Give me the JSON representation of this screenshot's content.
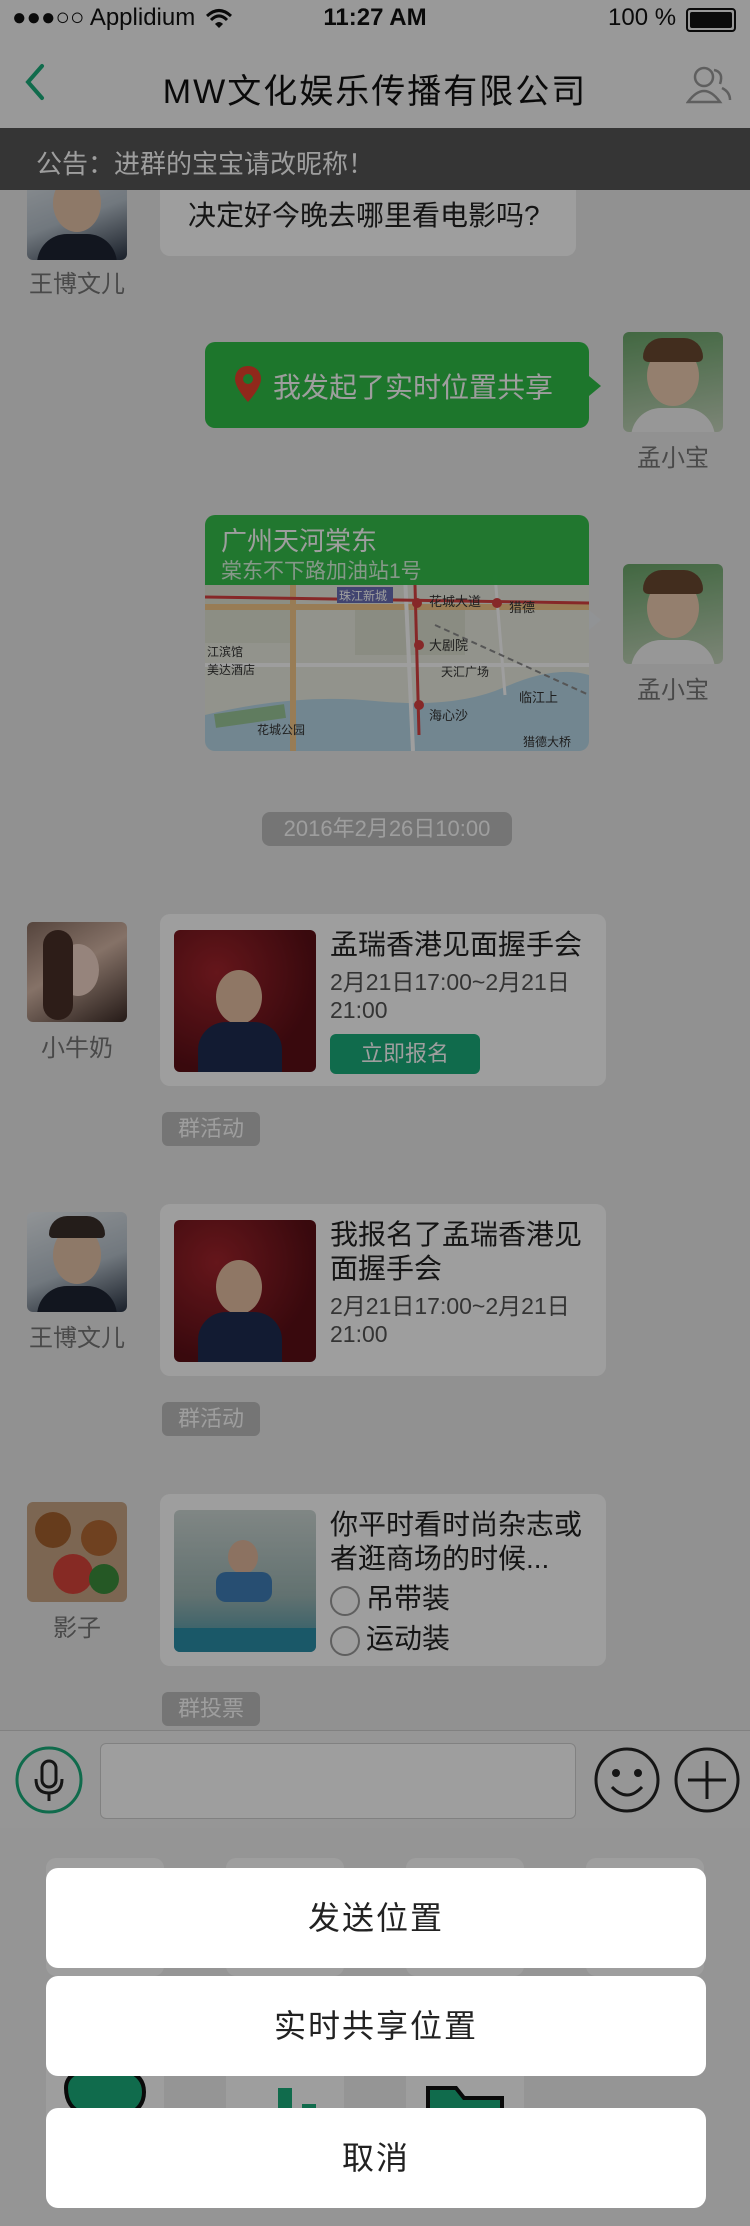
{
  "status_bar": {
    "carrier": "●●●○○ Applidium",
    "time": "11:27 AM",
    "battery": "100 %"
  },
  "nav": {
    "title": "MW文化娱乐传播有限公司"
  },
  "notice": {
    "text": "公告：进群的宝宝请改昵称！"
  },
  "messages": {
    "m1": {
      "sender": "王博文儿",
      "text": "决定好今晚去哪里看电影吗?"
    },
    "m2": {
      "sender": "孟小宝",
      "text": "我发起了实时位置共享"
    },
    "m3": {
      "sender": "孟小宝",
      "place": "广州天河棠东",
      "address": "棠东不下路加油站1号",
      "map_labels": [
        "珠江新城",
        "花城大道",
        "猎德",
        "大剧院",
        "江滨馆",
        "美达酒店",
        "天汇广场",
        "临江上",
        "海心沙",
        "花城公园",
        "猎德大桥"
      ]
    },
    "timestamp": "2016年2月26日10:00",
    "m4": {
      "sender": "小牛奶",
      "title": "孟瑞香港见面握手会",
      "time": "2月21日17:00~2月21日21:00",
      "button": "立即报名",
      "tag": "群活动"
    },
    "m5": {
      "sender": "王博文儿",
      "title": "我报名了孟瑞香港见面握手会",
      "time": "2月21日17:00~2月21日21:00",
      "tag": "群活动"
    },
    "m6": {
      "sender": "影子",
      "question": "你平时看时尚杂志或者逛商场的时候...",
      "options": [
        "吊带装",
        "运动装"
      ],
      "tag": "群投票"
    }
  },
  "action_sheet": {
    "send_location": "发送位置",
    "share_realtime": "实时共享位置",
    "cancel": "取消"
  },
  "colors": {
    "accent_green": "#2fbe48",
    "nav_icon": "#1aad7b",
    "tag_gray": "#bdbdbd"
  },
  "icons": [
    "back-chevron-icon",
    "group-members-icon",
    "location-pin-icon",
    "microphone-icon",
    "emoji-icon",
    "plus-icon"
  ]
}
